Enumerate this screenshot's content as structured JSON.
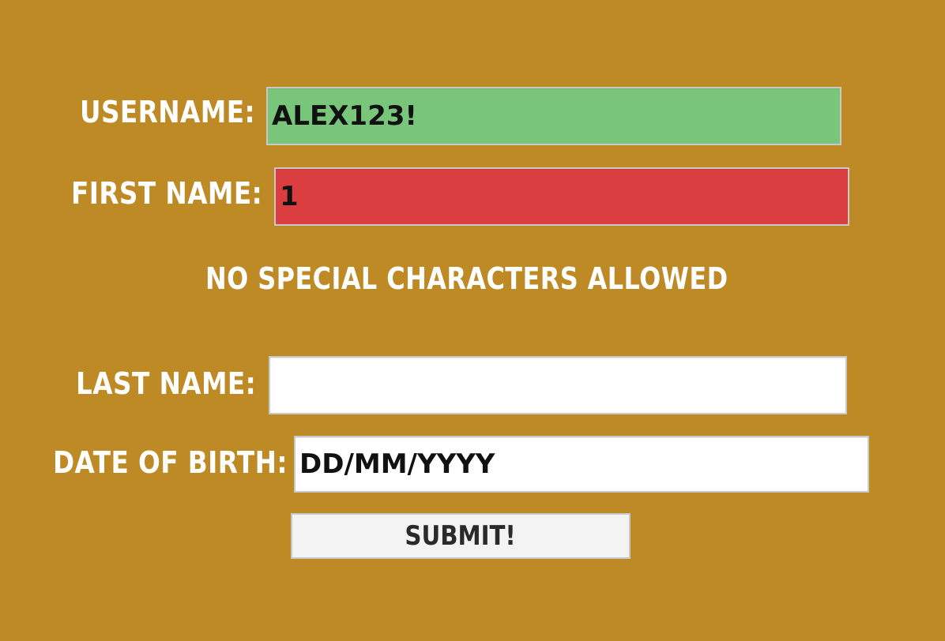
{
  "form": {
    "username": {
      "label": "USERNAME:",
      "value": "ALEX123!",
      "status_color": "#79c67a"
    },
    "first_name": {
      "label": "FIRST NAME:",
      "value": "1",
      "status_color": "#db3e41"
    },
    "error_message": "NO SPECIAL CHARACTERS ALLOWED",
    "last_name": {
      "label": "LAST NAME:",
      "value": ""
    },
    "date_of_birth": {
      "label": "DATE OF BIRTH:",
      "placeholder": "DD/MM/YYYY"
    },
    "submit_label": "SUBMIT!"
  },
  "colors": {
    "background": "#be8a25",
    "label": "#ffffff",
    "valid_field": "#79c67a",
    "invalid_field": "#db3e41",
    "empty_field": "#ffffff",
    "button": "#f3f3f3"
  }
}
